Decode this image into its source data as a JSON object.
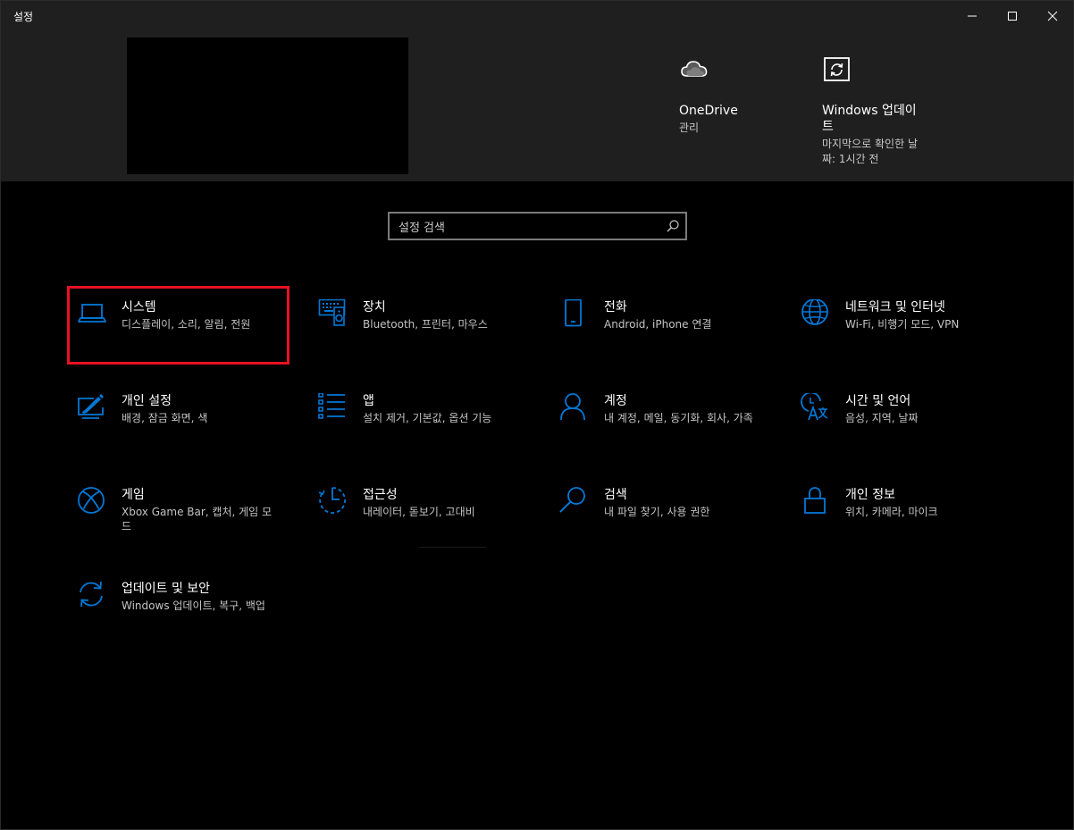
{
  "window": {
    "title": "설정",
    "controls": {
      "minimize": "minimize-icon",
      "maximize": "maximize-icon",
      "close": "close-icon"
    }
  },
  "header": {
    "quick_links": [
      {
        "icon": "cloud-icon",
        "title": "OneDrive",
        "subtitle": "관리"
      },
      {
        "icon": "update-icon",
        "title": "Windows 업데이트",
        "subtitle": "마지막으로 확인한 날짜: 1시간 전"
      }
    ]
  },
  "search": {
    "placeholder": "설정 검색",
    "icon": "search-icon"
  },
  "categories": [
    {
      "icon": "laptop-icon",
      "title": "시스템",
      "subtitle": "디스플레이, 소리, 알림, 전원"
    },
    {
      "icon": "devices-icon",
      "title": "장치",
      "subtitle": "Bluetooth, 프린터, 마우스"
    },
    {
      "icon": "phone-icon",
      "title": "전화",
      "subtitle": "Android, iPhone 연결"
    },
    {
      "icon": "globe-icon",
      "title": "네트워크 및 인터넷",
      "subtitle": "Wi-Fi, 비행기 모드, VPN"
    },
    {
      "icon": "paint-icon",
      "title": "개인 설정",
      "subtitle": "배경, 잠금 화면, 색"
    },
    {
      "icon": "apps-list-icon",
      "title": "앱",
      "subtitle": "설치 제거, 기본값, 옵션 기능"
    },
    {
      "icon": "person-icon",
      "title": "계정",
      "subtitle": "내 계정, 메일, 동기화, 회사, 가족"
    },
    {
      "icon": "time-language-icon",
      "title": "시간 및 언어",
      "subtitle": "음성, 지역, 날짜"
    },
    {
      "icon": "xbox-icon",
      "title": "게임",
      "subtitle": "Xbox Game Bar, 캡처, 게임 모드"
    },
    {
      "icon": "accessibility-icon",
      "title": "접근성",
      "subtitle": "내레이터, 돋보기, 고대비"
    },
    {
      "icon": "search-icon",
      "title": "검색",
      "subtitle": "내 파일 찾기, 사용 권한"
    },
    {
      "icon": "lock-icon",
      "title": "개인 정보",
      "subtitle": "위치, 카메라, 마이크"
    },
    {
      "icon": "sync-icon",
      "title": "업데이트 및 보안",
      "subtitle": "Windows 업데이트, 복구, 백업"
    }
  ],
  "colors": {
    "accent": "#0078d7",
    "highlight": "#e81123",
    "header_bg": "#1f1f1f",
    "background": "#000000"
  }
}
